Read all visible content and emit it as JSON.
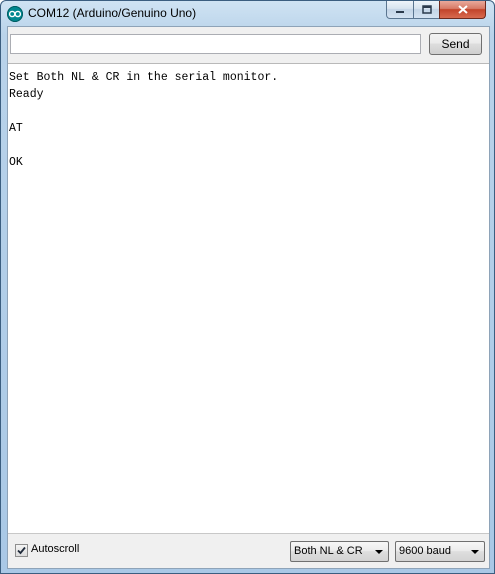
{
  "window": {
    "title": "COM12 (Arduino/Genuino Uno)",
    "icon": "arduino-logo-icon",
    "controls": {
      "minimize": "minimize-icon",
      "maximize": "maximize-icon",
      "close": "close-icon"
    }
  },
  "input_bar": {
    "value": "",
    "send_label": "Send"
  },
  "output": {
    "lines": [
      "Set Both NL & CR in the serial monitor.",
      "Ready",
      "AT",
      "OK"
    ]
  },
  "status_bar": {
    "autoscroll_label": "Autoscroll",
    "autoscroll_checked": true,
    "line_ending": "Both NL & CR",
    "baud_rate": "9600 baud"
  },
  "colors": {
    "titlebar": "#b9d3ea",
    "close_button": "#c2432a",
    "arduino_teal": "#00878f"
  }
}
